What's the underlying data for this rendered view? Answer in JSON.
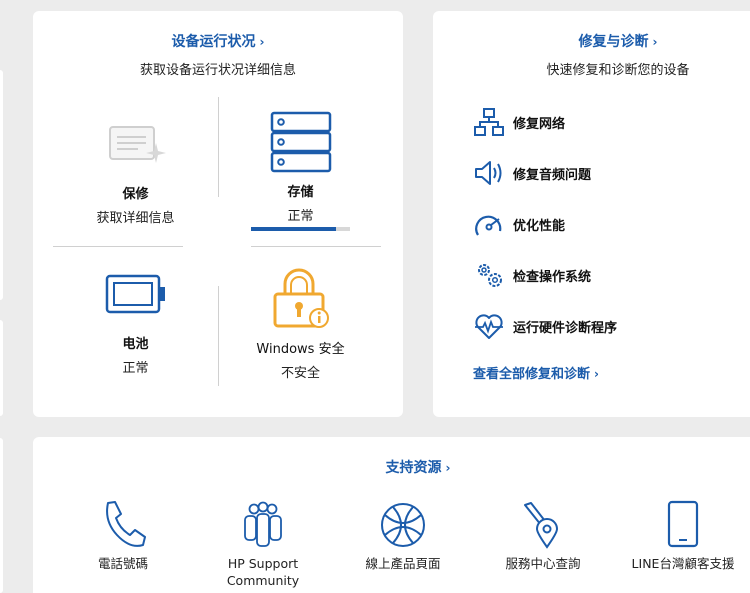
{
  "health": {
    "title": "设备运行状况",
    "subtitle": "获取设备运行状况详细信息",
    "warranty": {
      "label": "保修",
      "value": "获取详细信息"
    },
    "storage": {
      "label": "存储",
      "value": "正常",
      "progress": 0.86
    },
    "battery": {
      "label": "电池",
      "value": "正常"
    },
    "security": {
      "label": "Windows 安全",
      "value": "不安全"
    }
  },
  "diagnostics": {
    "title": "修复与诊断",
    "subtitle": "快速修复和诊断您的设备",
    "items": [
      {
        "label": "修复网络",
        "icon": "network-icon"
      },
      {
        "label": "修复音频问题",
        "icon": "speaker-icon"
      },
      {
        "label": "优化性能",
        "icon": "gauge-icon"
      },
      {
        "label": "检查操作系统",
        "icon": "gears-icon"
      },
      {
        "label": "运行硬件诊断程序",
        "icon": "heartbeat-icon"
      }
    ],
    "all_link": "查看全部修复和诊断"
  },
  "support": {
    "title": "支持资源",
    "items": [
      {
        "label": "電話號碼",
        "icon": "phone-icon"
      },
      {
        "label": "HP Support Community",
        "icon": "community-icon"
      },
      {
        "label": "線上產品頁面",
        "icon": "globe-icon"
      },
      {
        "label": "服務中心查詢",
        "icon": "location-icon"
      },
      {
        "label": "LINE台灣顧客支援",
        "icon": "mobile-icon"
      }
    ]
  },
  "colors": {
    "accent": "#1c5cab",
    "warning": "#f0a830",
    "background": "#ececec"
  },
  "chevron": "›"
}
